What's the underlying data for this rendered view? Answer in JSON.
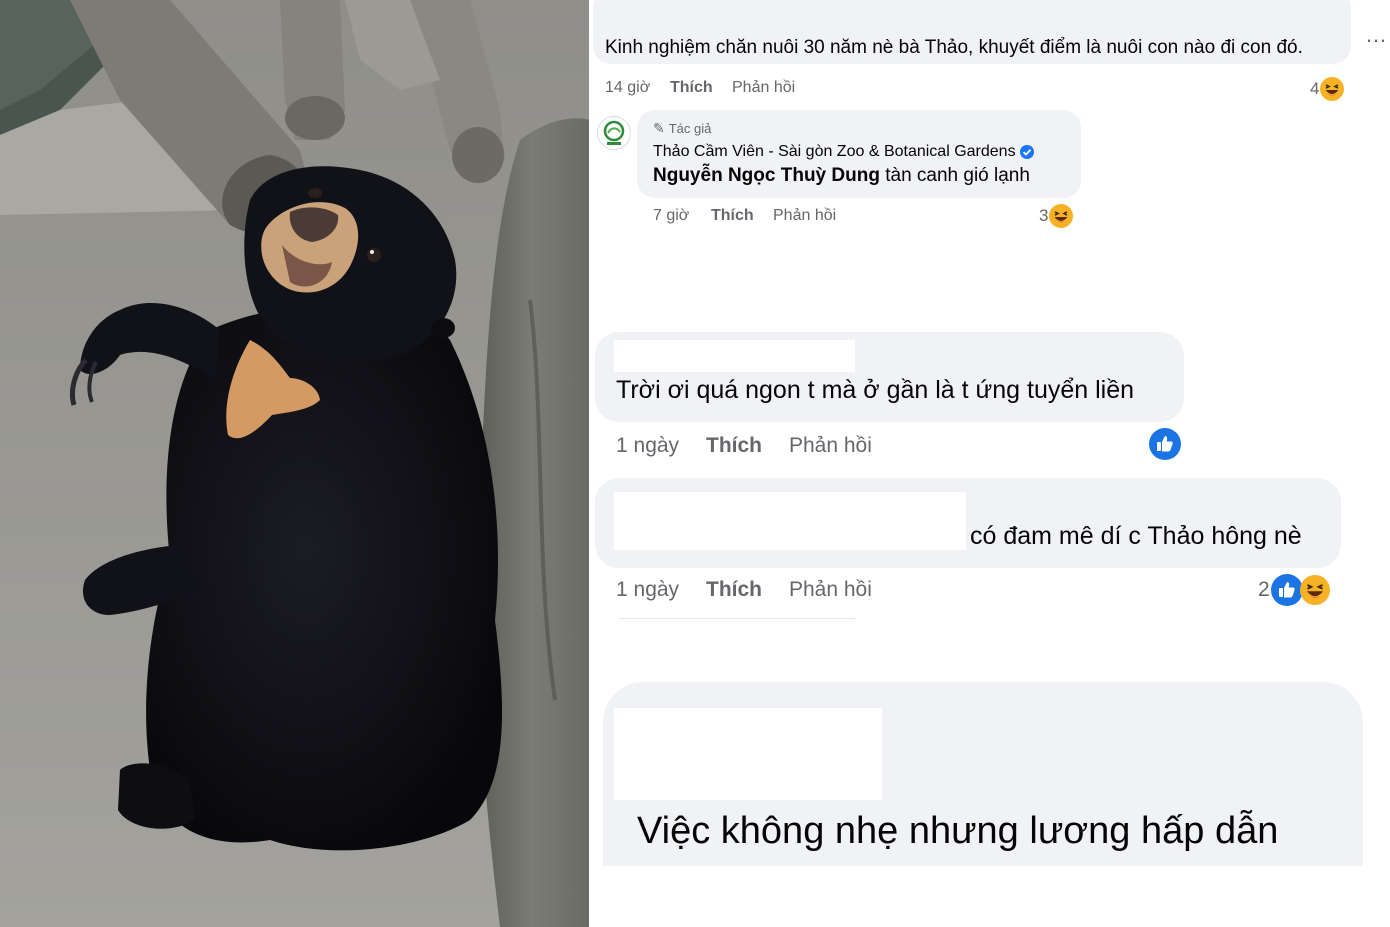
{
  "photo": {
    "subject": "sun-bear"
  },
  "comments": [
    {
      "text": "Kinh nghiệm chăn nuôi 30 năm nè bà Thảo, khuyết điểm là nuôi con nào đi con đó.",
      "time": "14 giờ",
      "like_label": "Thích",
      "reply_label": "Phản hồi",
      "reaction_count": "4",
      "reactions": [
        "haha-icon"
      ]
    },
    {
      "author_badge": "Tác giả",
      "author": "Thảo Cầm Viên - Sài gòn Zoo & Botanical Gardens",
      "mention": "Nguyễn Ngọc Thuỳ Dung",
      "text": "tàn canh gió lạnh",
      "time": "7 giờ",
      "like_label": "Thích",
      "reply_label": "Phản hồi",
      "reaction_count": "3",
      "reactions": [
        "haha-icon"
      ]
    },
    {
      "text": "Trời ơi quá ngon t mà ở gần là t ứng tuyển liền",
      "time": "1 ngày",
      "like_label": "Thích",
      "reply_label": "Phản hồi",
      "reaction_count": "",
      "reactions": [
        "like-icon"
      ]
    },
    {
      "text": "có đam mê dí c Thảo hông nè",
      "time": "1 ngày",
      "like_label": "Thích",
      "reply_label": "Phản hồi",
      "reaction_count": "2",
      "reactions": [
        "like-icon",
        "haha-icon"
      ]
    },
    {
      "text": "Việc không nhẹ nhưng lương hấp dẫn"
    }
  ],
  "more_menu": "…",
  "colors": {
    "bubble": "#f0f2f5",
    "meta": "#65676b",
    "like_blue": "#1b74e4",
    "haha_yellow": "#f7b125",
    "verified": "#1877f2"
  }
}
